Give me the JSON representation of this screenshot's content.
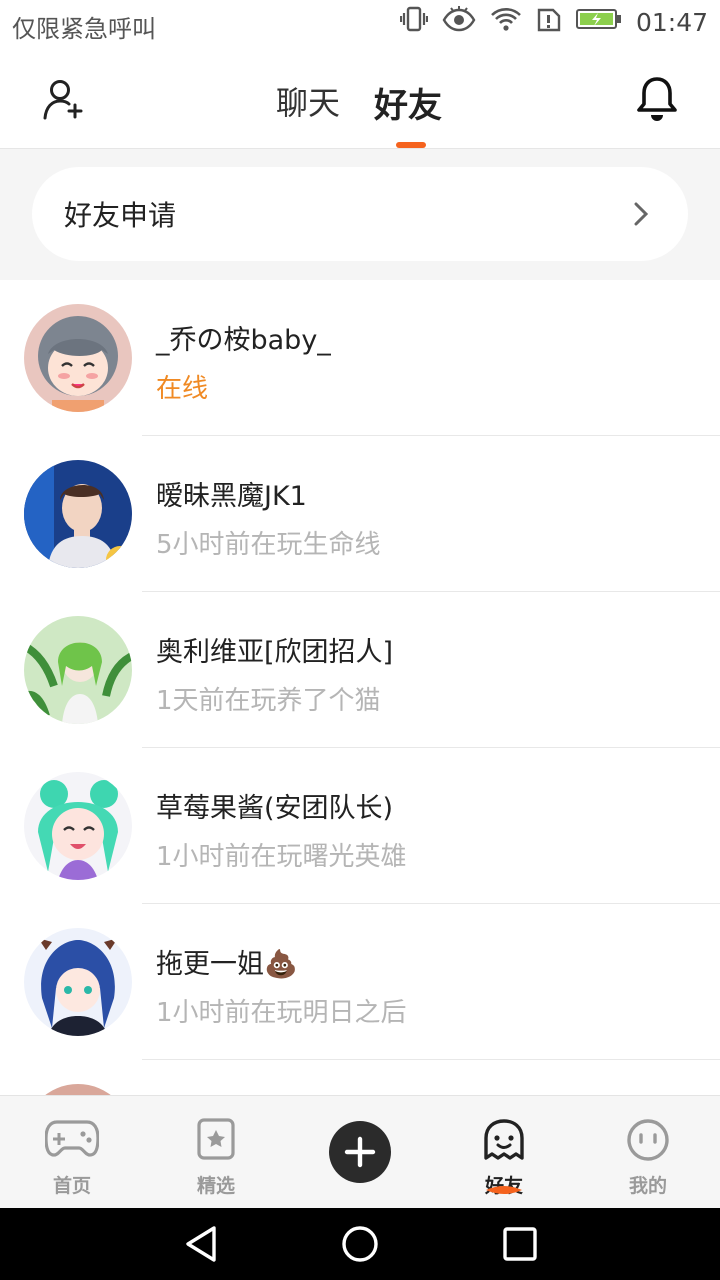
{
  "status_bar": {
    "carrier": "仅限紧急呼叫",
    "time": "01:47"
  },
  "header": {
    "tabs": [
      {
        "label": "聊天",
        "active": false
      },
      {
        "label": "好友",
        "active": true
      }
    ],
    "accent_color": "#f5631e"
  },
  "friend_request": {
    "label": "好友申请"
  },
  "friends": [
    {
      "name": "_乔の桉baby_",
      "status": "在线",
      "online": true
    },
    {
      "name": "暧昧黑魔JK1",
      "status": "5小时前在玩生命线",
      "online": false
    },
    {
      "name": "奥利维亚[欣团招人]",
      "status": "1天前在玩养了个猫",
      "online": false
    },
    {
      "name": "草莓果酱(安团队长)",
      "status": "1小时前在玩曙光英雄",
      "online": false
    },
    {
      "name": "拖更一姐💩",
      "status": "1小时前在玩明日之后",
      "online": false
    }
  ],
  "bottom_nav": {
    "items": [
      {
        "label": "首页",
        "icon": "gamepad-icon"
      },
      {
        "label": "精选",
        "icon": "star-bookmark-icon"
      },
      {
        "label": "",
        "icon": "plus-icon"
      },
      {
        "label": "好友",
        "icon": "ghost-icon",
        "active": true
      },
      {
        "label": "我的",
        "icon": "face-icon"
      }
    ]
  }
}
